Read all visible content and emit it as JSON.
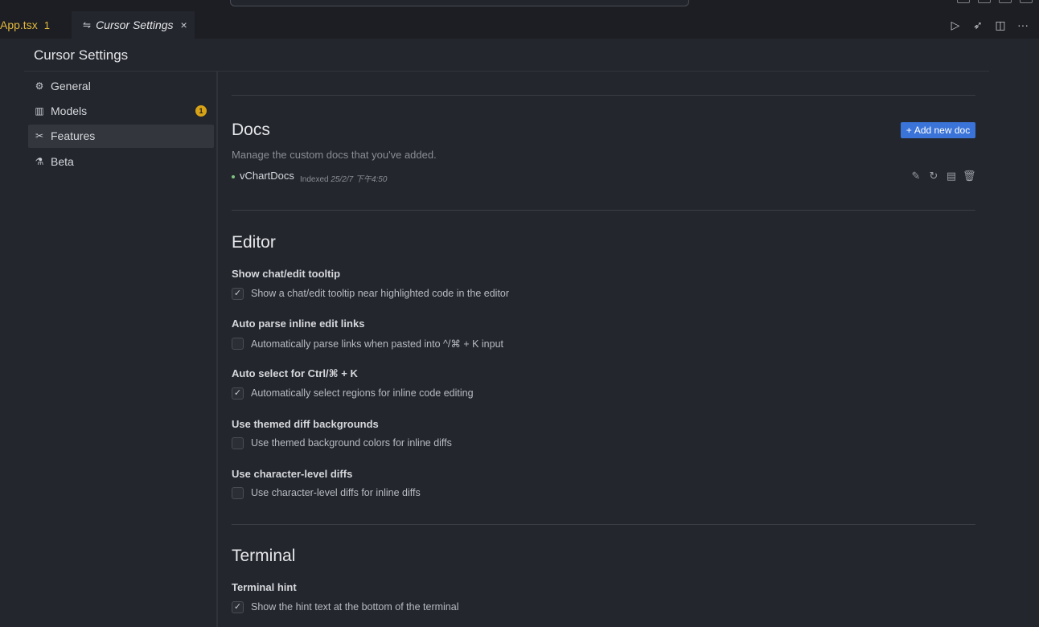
{
  "tabs": [
    {
      "label": "App.tsx",
      "badge": "1"
    },
    {
      "label": "Cursor Settings",
      "icon": "settings-sliders-icon",
      "close": "×"
    }
  ],
  "tab_actions": [
    {
      "icon": "run-debug-icon",
      "glyph": "▷"
    },
    {
      "icon": "rocket-icon",
      "glyph": "➶"
    },
    {
      "icon": "split-editor-icon",
      "glyph": "◫"
    },
    {
      "icon": "more-icon",
      "glyph": "···"
    }
  ],
  "page_title": "Cursor Settings",
  "sidebar": {
    "items": [
      {
        "label": "General",
        "icon": "gear-icon",
        "glyph": "⚙"
      },
      {
        "label": "Models",
        "icon": "chart-icon",
        "glyph": "▥",
        "badge": "1"
      },
      {
        "label": "Features",
        "icon": "tools-icon",
        "glyph": "✂",
        "active": true
      },
      {
        "label": "Beta",
        "icon": "flask-icon",
        "glyph": "⚗"
      }
    ]
  },
  "docs": {
    "title": "Docs",
    "description": "Manage the custom docs that you've added.",
    "add_button": "Add new doc",
    "add_button_icon": "+",
    "items": [
      {
        "name": "vChartDocs",
        "indexed_label": "Indexed",
        "date": "25/2/7 下午4:50"
      }
    ],
    "item_actions": [
      {
        "icon": "edit-icon",
        "glyph": "✎"
      },
      {
        "icon": "refresh-icon",
        "glyph": "↻"
      },
      {
        "icon": "book-icon",
        "glyph": "▤"
      },
      {
        "icon": "trash-icon",
        "glyph": "🗑"
      }
    ]
  },
  "editor": {
    "title": "Editor",
    "settings": [
      {
        "title": "Show chat/edit tooltip",
        "desc": "Show a chat/edit tooltip near highlighted code in the editor",
        "checked": true
      },
      {
        "title": "Auto parse inline edit links",
        "desc": "Automatically parse links when pasted into ^/⌘ + K input",
        "checked": false
      },
      {
        "title": "Auto select for Ctrl/⌘ + K",
        "desc": "Automatically select regions for inline code editing",
        "checked": true
      },
      {
        "title": "Use themed diff backgrounds",
        "desc": "Use themed background colors for inline diffs",
        "checked": false
      },
      {
        "title": "Use character-level diffs",
        "desc": "Use character-level diffs for inline diffs",
        "checked": false
      }
    ]
  },
  "terminal": {
    "title": "Terminal",
    "settings": [
      {
        "title": "Terminal hint",
        "desc": "Show the hint text at the bottom of the terminal",
        "checked": true
      }
    ]
  },
  "colors": {
    "accent": "#3b74d9",
    "warning_badge": "#d9a315",
    "tab_modified": "#e2b93d"
  }
}
